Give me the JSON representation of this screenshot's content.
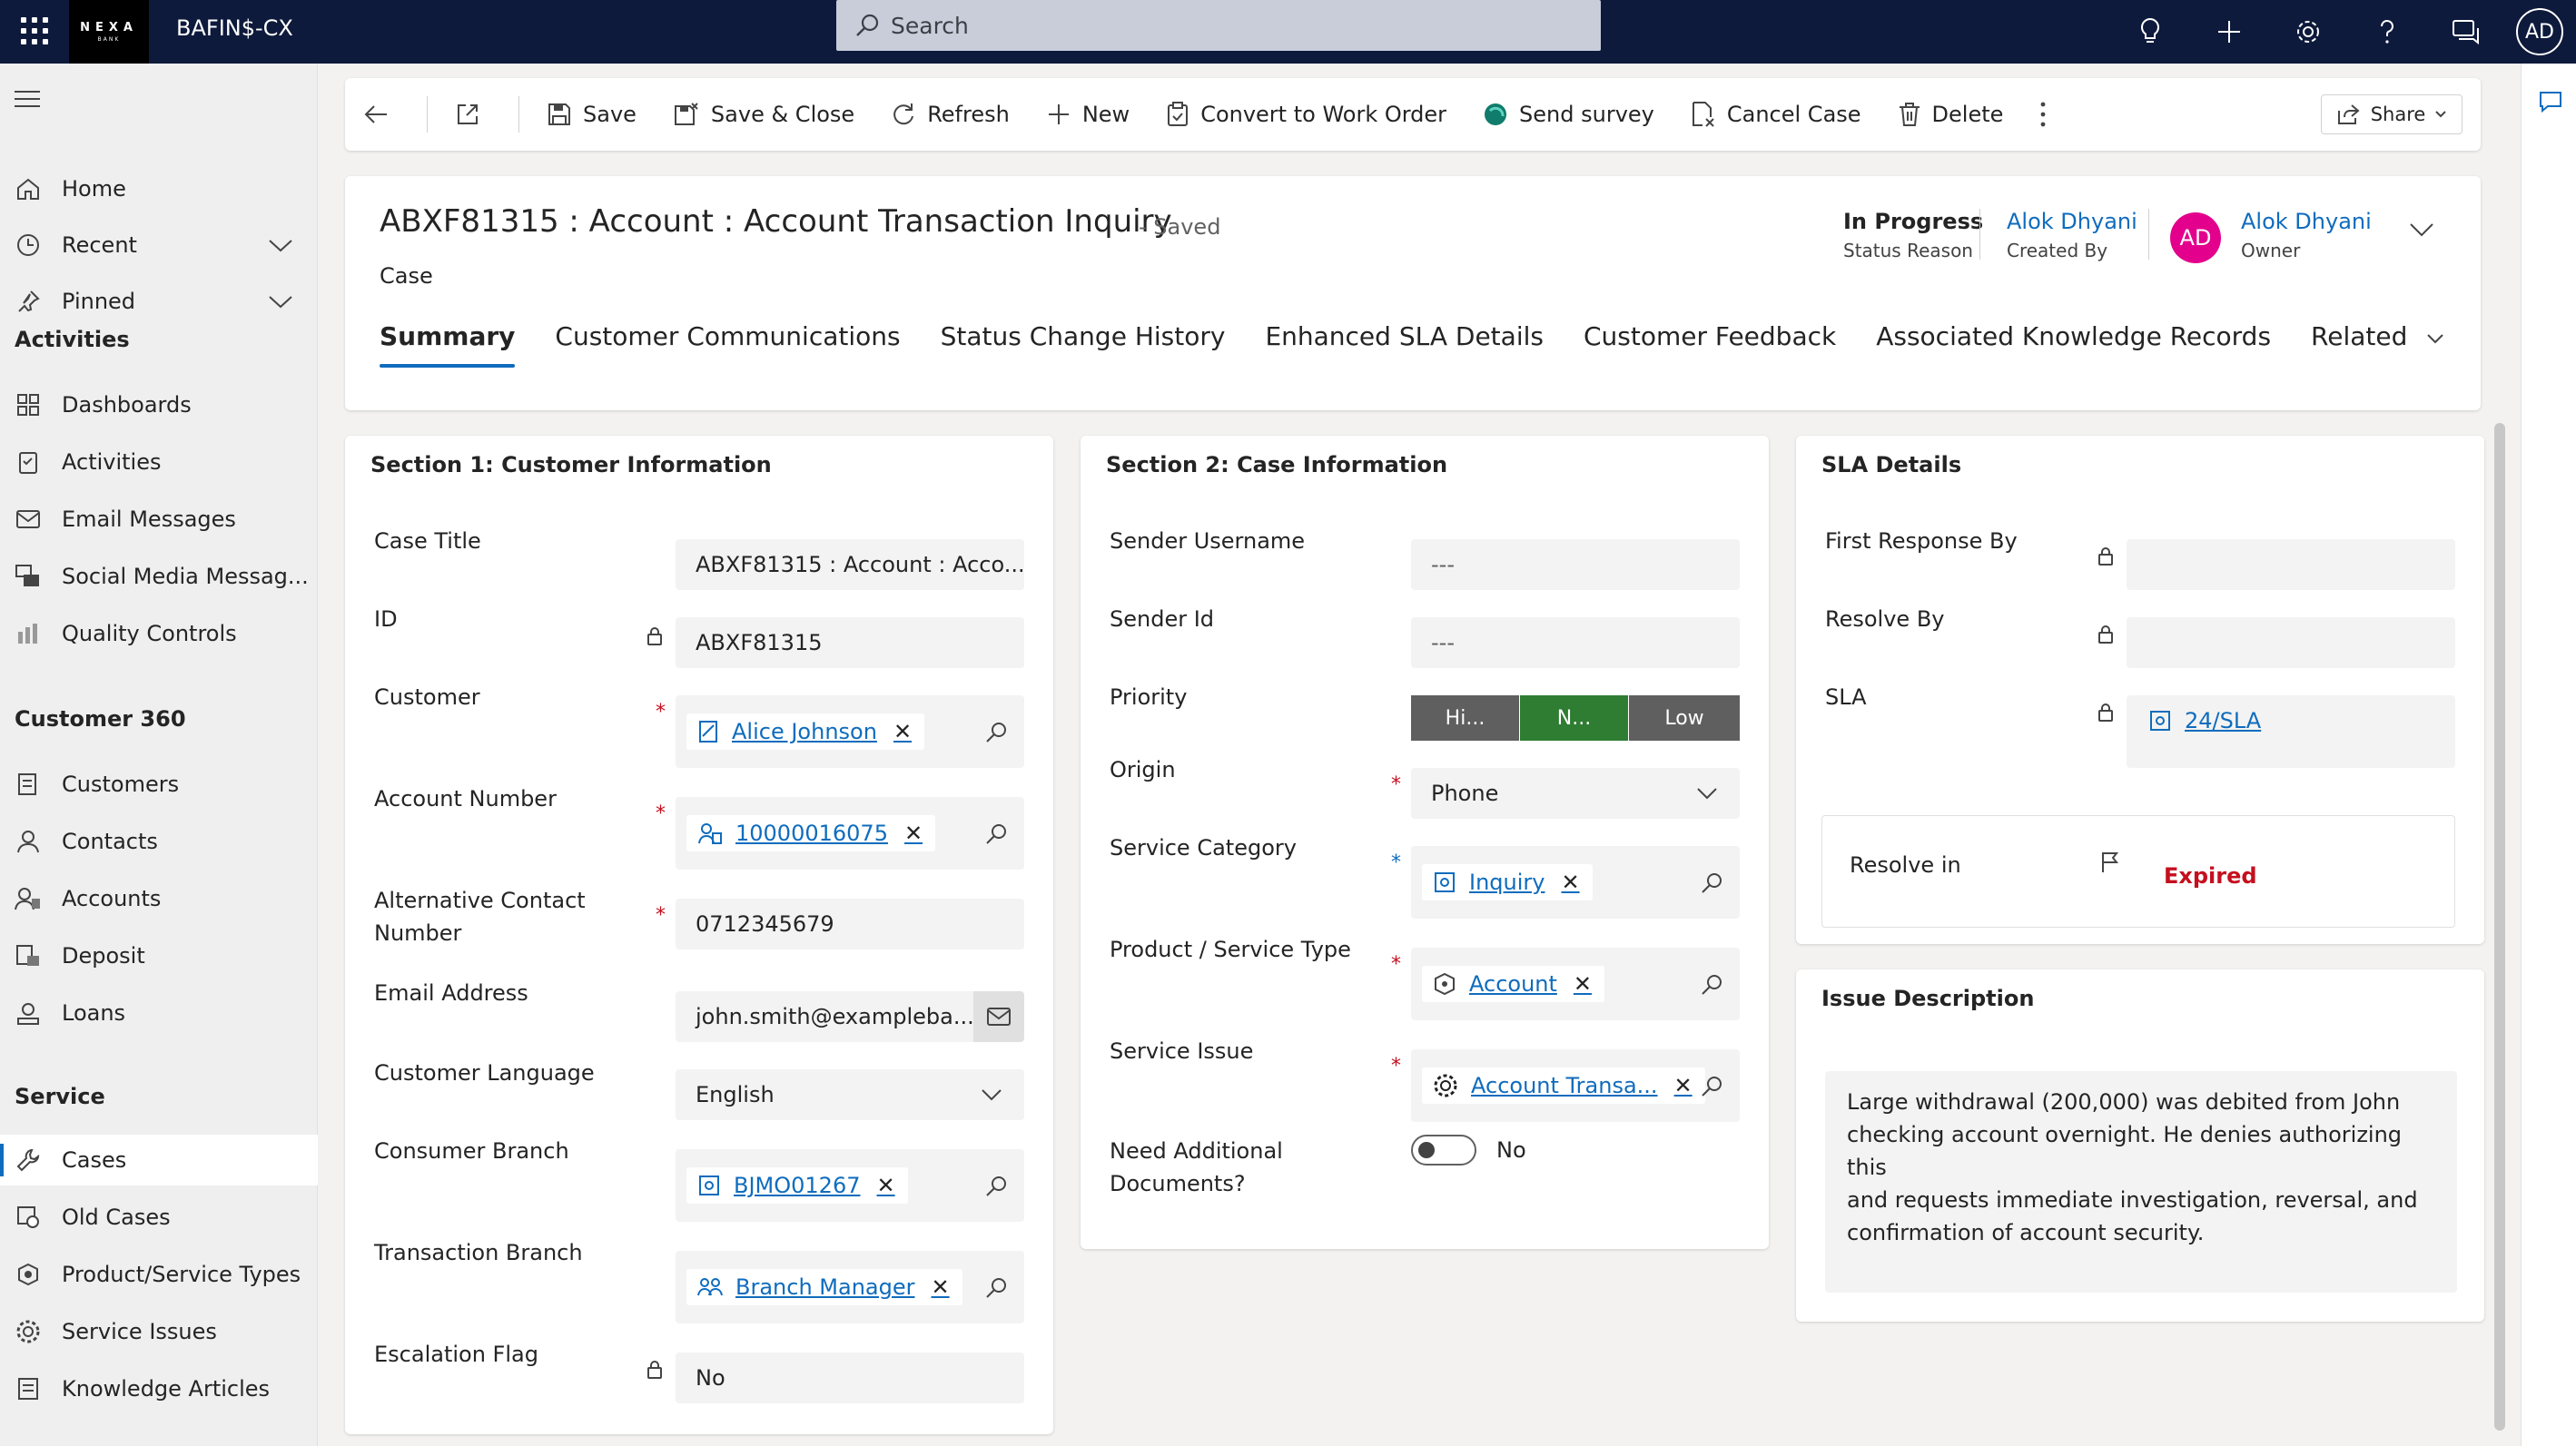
{
  "app": {
    "brand_line1": "NEXA",
    "brand_line2": "BANK",
    "name": "BAFIN$-CX"
  },
  "search": {
    "placeholder": "Search"
  },
  "user": {
    "initials": "AD"
  },
  "nav": {
    "home": "Home",
    "recent": "Recent",
    "pinned": "Pinned",
    "group_activities": "Activities",
    "dashboards": "Dashboards",
    "activities": "Activities",
    "email_messages": "Email Messages",
    "social_media": "Social Media Messag...",
    "quality_controls": "Quality Controls",
    "group_customer360": "Customer 360",
    "customers": "Customers",
    "contacts": "Contacts",
    "accounts": "Accounts",
    "deposit": "Deposit",
    "loans": "Loans",
    "group_service": "Service",
    "cases": "Cases",
    "old_cases": "Old Cases",
    "product_service_types": "Product/Service Types",
    "service_issues": "Service Issues",
    "knowledge_articles": "Knowledge Articles"
  },
  "toolbar": {
    "save": "Save",
    "save_close": "Save & Close",
    "refresh": "Refresh",
    "new": "New",
    "convert": "Convert to Work Order",
    "send_survey": "Send survey",
    "cancel_case": "Cancel Case",
    "delete": "Delete",
    "share": "Share"
  },
  "header": {
    "title": "ABXF81315 : Account : Account Transaction Inquiry",
    "saved": "- Saved",
    "entity": "Case",
    "status_value": "In Progress",
    "status_label": "Status Reason",
    "created_by_value": "Alok Dhyani",
    "created_by_label": "Created By",
    "owner_initials": "AD",
    "owner_value": "Alok Dhyani",
    "owner_label": "Owner"
  },
  "tabs": {
    "summary": "Summary",
    "communications": "Customer Communications",
    "status_history": "Status Change History",
    "sla_details": "Enhanced SLA Details",
    "feedback": "Customer Feedback",
    "knowledge": "Associated Knowledge Records",
    "related": "Related"
  },
  "section1": {
    "title": "Section 1: Customer Information",
    "case_title_label": "Case Title",
    "case_title_value": "ABXF81315 : Account : Acco...",
    "id_label": "ID",
    "id_value": "ABXF81315",
    "customer_label": "Customer",
    "customer_value": "Alice Johnson",
    "account_number_label": "Account Number",
    "account_number_value": "10000016075",
    "alt_contact_label_1": "Alternative Contact",
    "alt_contact_label_2": "Number",
    "alt_contact_value": "0712345679",
    "email_label": "Email Address",
    "email_value": "john.smith@exampleba...",
    "language_label": "Customer Language",
    "language_value": "English",
    "consumer_branch_label": "Consumer Branch",
    "consumer_branch_value": "BJMO01267",
    "transaction_branch_label": "Transaction Branch",
    "transaction_branch_value": "Branch Manager",
    "escalation_label": "Escalation Flag",
    "escalation_value": "No"
  },
  "section2": {
    "title": "Section 2: Case Information",
    "sender_username_label": "Sender Username",
    "sender_username_value": "---",
    "sender_id_label": "Sender Id",
    "sender_id_value": "---",
    "priority_label": "Priority",
    "priority_high": "Hi...",
    "priority_normal": "N...",
    "priority_low": "Low",
    "origin_label": "Origin",
    "origin_value": "Phone",
    "service_category_label": "Service Category",
    "service_category_value": "Inquiry",
    "product_type_label": "Product / Service Type",
    "product_type_value": "Account",
    "service_issue_label": "Service Issue",
    "service_issue_value": "Account Transa...",
    "need_docs_label_1": "Need Additional",
    "need_docs_label_2": "Documents?",
    "need_docs_value": "No"
  },
  "sla": {
    "title": "SLA Details",
    "first_response_label": "First Response By",
    "resolve_by_label": "Resolve By",
    "sla_label": "SLA",
    "sla_value": "24/SLA",
    "resolve_in_label": "Resolve in",
    "resolve_in_value": "Expired"
  },
  "issue": {
    "title": "Issue Description",
    "line1": "Large withdrawal (200,000) was debited from John",
    "line2": "checking account overnight. He denies authorizing this",
    "line3": "and requests immediate investigation, reversal, and",
    "line4": "confirmation of account security."
  },
  "colors": {
    "accent": "#0f6cbd",
    "topbar": "#0e1a3c",
    "priority_selected": "#2e7d32",
    "priority_other": "#5f5f5f",
    "expired": "#c50f1f",
    "owner_avatar": "#e3008c"
  }
}
